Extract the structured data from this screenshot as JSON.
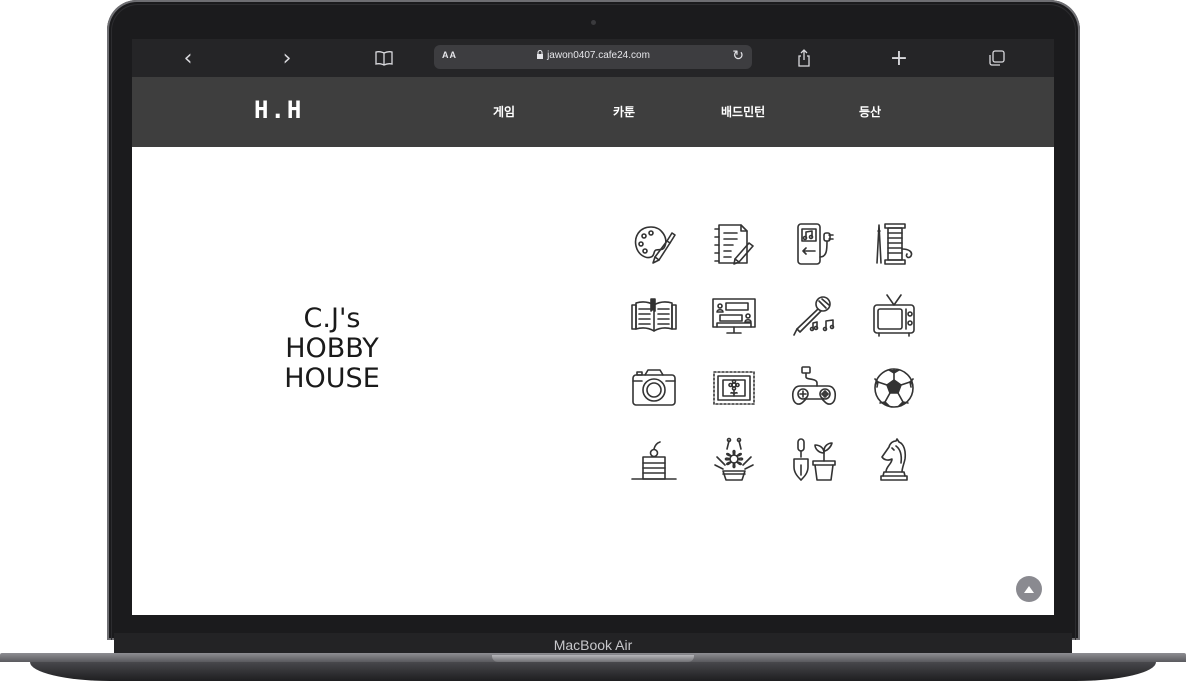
{
  "device": {
    "label": "MacBook Air"
  },
  "browser": {
    "back_icon": "‹",
    "forward_icon": "›",
    "reader_label": "AA",
    "url": "jawon0407.cafe24.com",
    "reload_icon": "↻",
    "share_icon": "share-icon",
    "new_tab_icon": "+",
    "tabs_icon": "tabs-icon"
  },
  "site": {
    "logo": "H.H",
    "menu": [
      "게임",
      "카툰",
      "배드민턴",
      "등산"
    ],
    "hero": {
      "line1": "C.J's",
      "line2": "HOBBY",
      "line3": "HOUSE"
    }
  },
  "icons": [
    "palette-icon",
    "notebook-pen-icon",
    "music-player-icon",
    "sewing-thread-icon",
    "open-book-icon",
    "video-chat-monitor-icon",
    "karaoke-microphone-icon",
    "retro-tv-icon",
    "camera-icon",
    "framed-flower-picture-icon",
    "gamepad-icon",
    "soccer-ball-icon",
    "cake-slice-icon",
    "flower-basket-icon",
    "garden-trowel-pot-icon",
    "chess-knight-icon"
  ],
  "colors": {
    "nav_bg": "#3e3e3e",
    "toolbar_bg": "#252527",
    "icon_stroke": "#333333"
  }
}
